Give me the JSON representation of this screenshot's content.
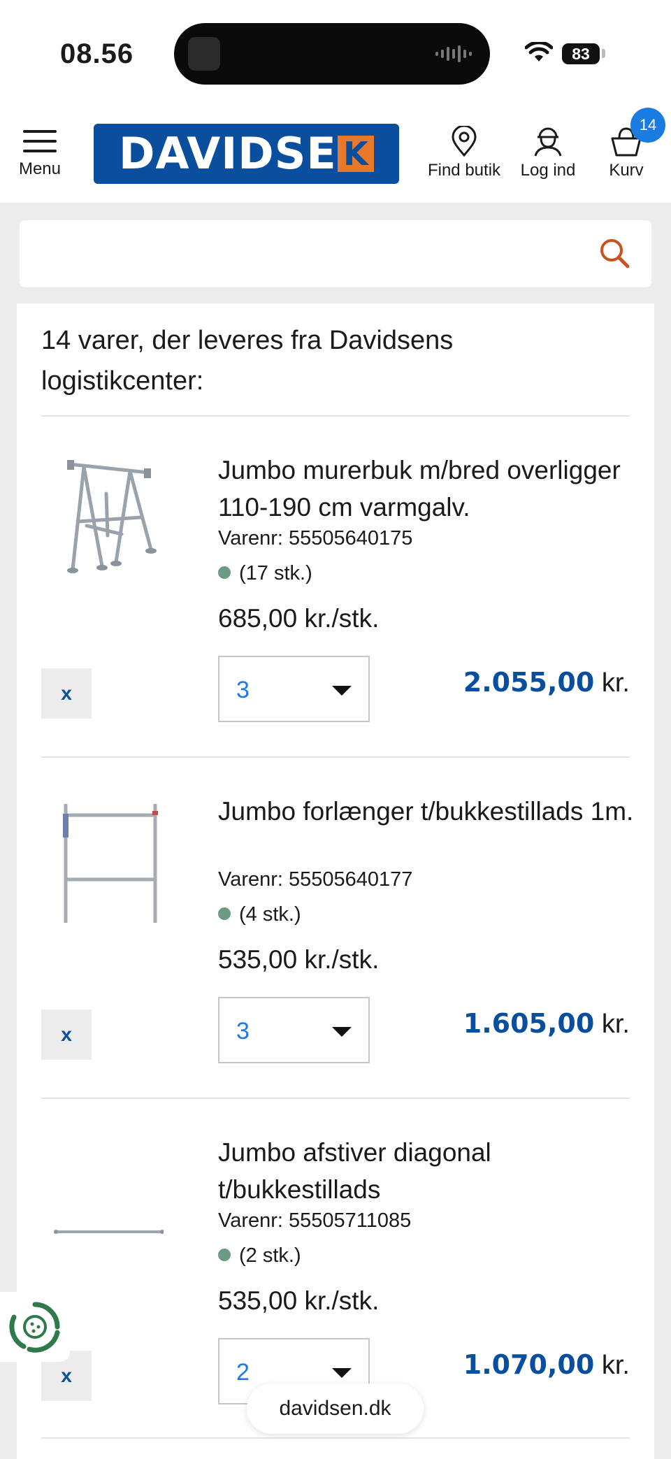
{
  "status_bar": {
    "time": "08.56",
    "battery": "83"
  },
  "header": {
    "menu_label": "Menu",
    "logo_text": "DAVIDSEN",
    "logo_k": "K",
    "find_store_label": "Find butik",
    "login_label": "Log ind",
    "cart_label": "Kurv",
    "cart_count": "14",
    "brand_color": "#0a4f9e",
    "accent_color": "#e8792a"
  },
  "search": {
    "value": "",
    "placeholder": ""
  },
  "cart": {
    "heading": "14 varer, der leveres fra Davidsens logistikcenter:",
    "items": [
      {
        "title": "Jumbo murerbuk m/bred overligger 110-190 cm varmgalv.",
        "varenr": "Varenr: 55505640175",
        "stock": "(17 stk.)",
        "unit_price": "685,00 kr./stk.",
        "quantity": "3",
        "total_amount": "2.055,00",
        "total_currency": "kr.",
        "remove_label": "x"
      },
      {
        "title": "Jumbo forlænger t/bukkestillads 1m.",
        "varenr": "Varenr: 55505640177",
        "stock": "(4 stk.)",
        "unit_price": "535,00 kr./stk.",
        "quantity": "3",
        "total_amount": "1.605,00",
        "total_currency": "kr.",
        "remove_label": "x"
      },
      {
        "title": "Jumbo afstiver diagonal t/bukkestillads",
        "varenr": "Varenr: 55505711085",
        "stock": "(2 stk.)",
        "unit_price": "535,00 kr./stk.",
        "quantity": "2",
        "total_amount": "1.070,00",
        "total_currency": "kr.",
        "remove_label": "x"
      }
    ]
  },
  "browser": {
    "url": "davidsen.dk"
  }
}
